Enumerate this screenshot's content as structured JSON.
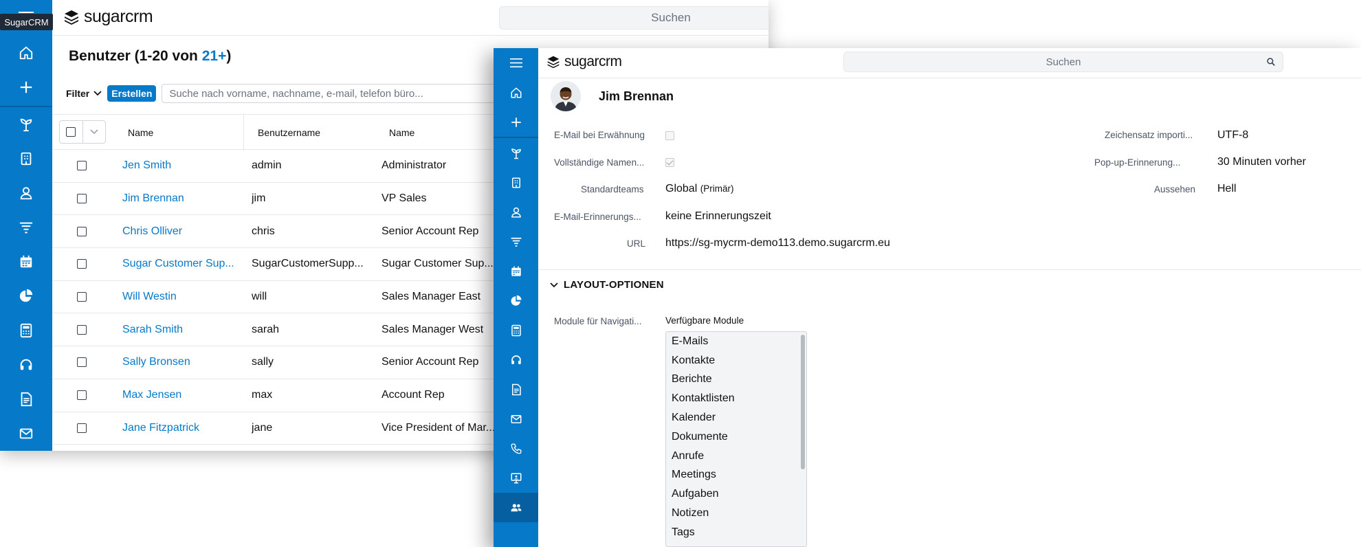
{
  "back_window": {
    "tooltip": "SugarCRM",
    "logo": {
      "part1": "sugar",
      "part2": "crm"
    },
    "search_placeholder": "Suchen",
    "list": {
      "title_prefix": "Benutzer (1-20 von ",
      "title_count": "21+",
      "title_suffix": ")",
      "filter_label": "Filter",
      "create_label": "Erstellen",
      "search_placeholder": "Suche nach vorname, nachname, e-mail, telefon büro...",
      "columns": [
        "Name",
        "Benutzername",
        "Name"
      ],
      "rows": [
        {
          "name": "Jen Smith",
          "user": "admin",
          "title": "Administrator"
        },
        {
          "name": "Jim Brennan",
          "user": "jim",
          "title": "VP Sales"
        },
        {
          "name": "Chris Olliver",
          "user": "chris",
          "title": "Senior Account Rep"
        },
        {
          "name": "Sugar Customer Sup...",
          "user": "SugarCustomerSupp...",
          "title": "Sugar Customer Sup..."
        },
        {
          "name": "Will Westin",
          "user": "will",
          "title": "Sales Manager East"
        },
        {
          "name": "Sarah Smith",
          "user": "sarah",
          "title": "Sales Manager West"
        },
        {
          "name": "Sally Bronsen",
          "user": "sally",
          "title": "Senior Account Rep"
        },
        {
          "name": "Max Jensen",
          "user": "max",
          "title": "Account Rep"
        },
        {
          "name": "Jane Fitzpatrick",
          "user": "jane",
          "title": "Vice President of Mar..."
        }
      ]
    }
  },
  "front_window": {
    "logo": {
      "part1": "sugar",
      "part2": "crm"
    },
    "search_placeholder": "Suchen",
    "record_name": "Jim Brennan",
    "fields_left": {
      "email_mention_label": "E-Mail bei Erwähnung",
      "full_names_label": "Vollständige Namen...",
      "default_teams_label": "Standardteams",
      "default_teams_value": "Global",
      "default_teams_primary": "(Primär)",
      "email_reminder_label": "E-Mail-Erinnerungs...",
      "email_reminder_value": "keine Erinnerungszeit",
      "url_label": "URL",
      "url_value": "https://sg-mycrm-demo113.demo.sugarcrm.eu"
    },
    "fields_right": {
      "charset_label": "Zeichensatz importi...",
      "charset_value": "UTF-8",
      "popup_label": "Pop-up-Erinnerung...",
      "popup_value": "30 Minuten vorher",
      "appearance_label": "Aussehen",
      "appearance_value": "Hell"
    },
    "layout_section": {
      "title": "LAYOUT-OPTIONEN",
      "modules_label": "Module für Navigati...",
      "available_label": "Verfügbare Module",
      "modules": [
        "E-Mails",
        "Kontakte",
        "Berichte",
        "Kontaktlisten",
        "Kalender",
        "Dokumente",
        "Anrufe",
        "Meetings",
        "Aufgaben",
        "Notizen",
        "Tags"
      ]
    }
  },
  "colors": {
    "brand": "#0679c8",
    "brand_dark": "#055fa0"
  }
}
